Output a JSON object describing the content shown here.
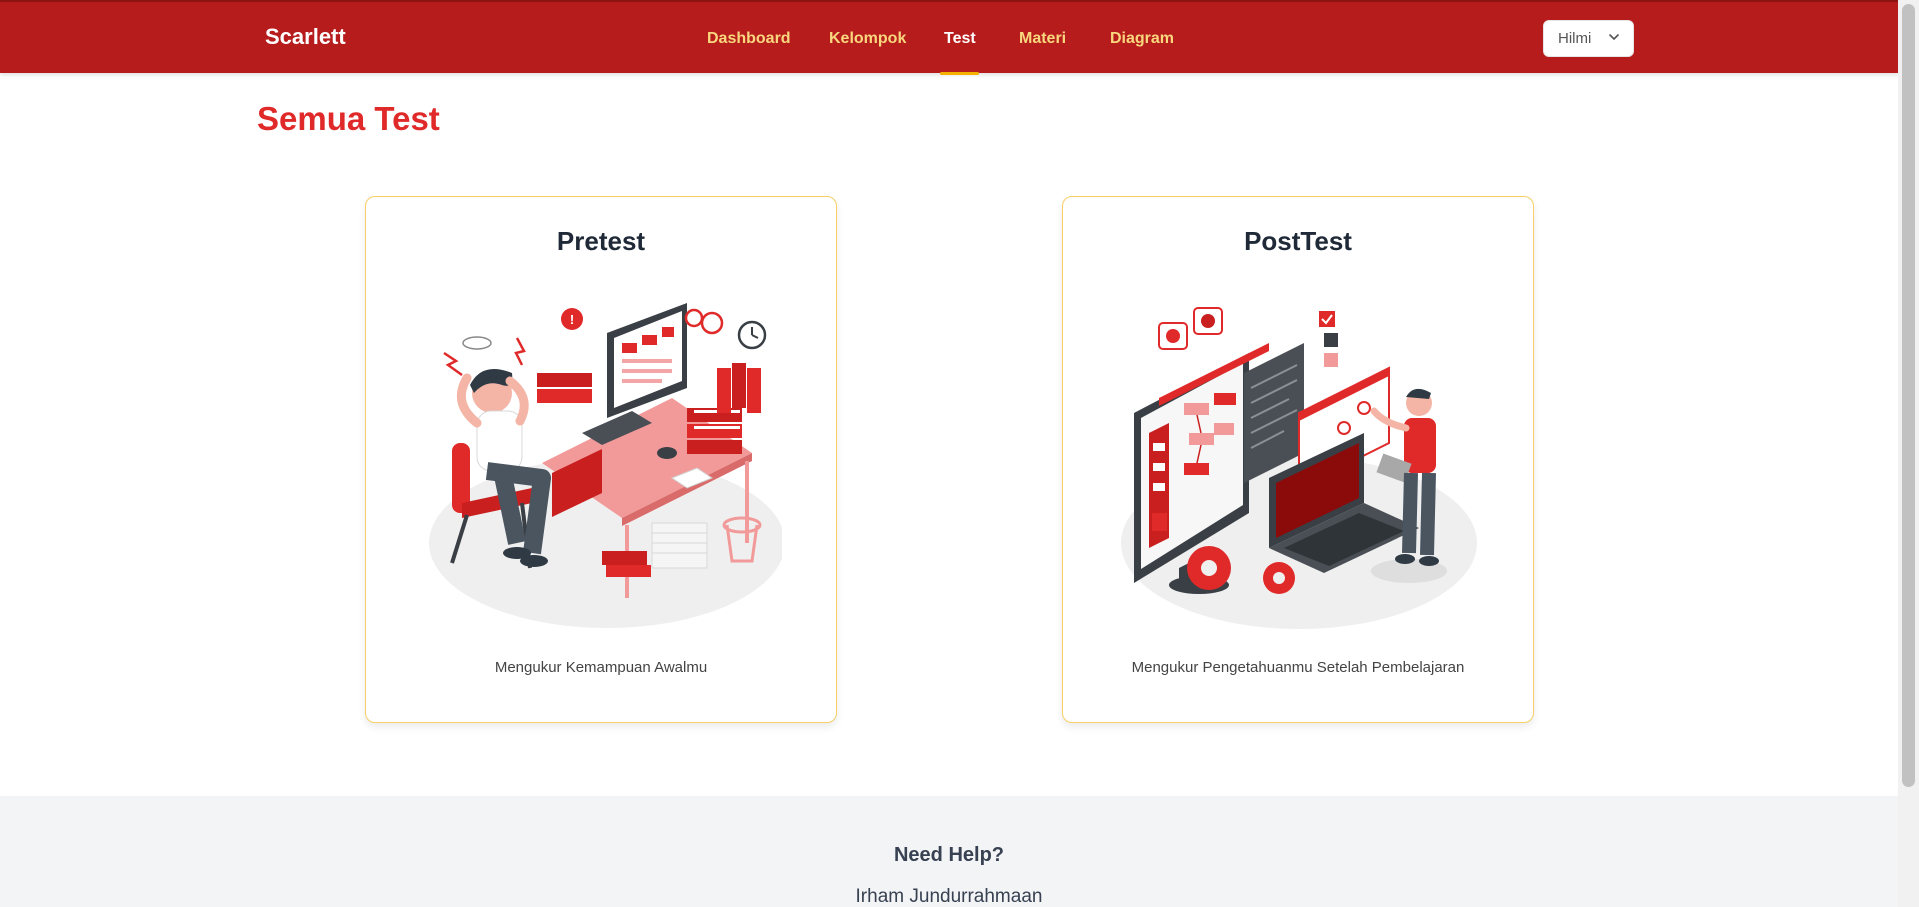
{
  "brand": "Scarlett",
  "nav": {
    "items": [
      {
        "label": "Dashboard"
      },
      {
        "label": "Kelompok"
      },
      {
        "label": "Test"
      },
      {
        "label": "Materi"
      },
      {
        "label": "Diagram"
      }
    ],
    "active": "Test",
    "user_label": "Hilmi"
  },
  "main": {
    "title": "Semua Test",
    "cards": [
      {
        "title": "Pretest",
        "description": "Mengukur Kemampuan Awalmu"
      },
      {
        "title": "PostTest",
        "description": "Mengukur Pengetahuanmu Setelah Pembelajaran"
      }
    ]
  },
  "footer": {
    "help_title": "Need Help?",
    "contact_name": "Irham Jundurrahmaan"
  },
  "colors": {
    "navbar": "#b71c1c",
    "nav_link": "#f8d77e",
    "active_underline": "#f5b100",
    "title": "#e02a2a",
    "card_border": "#f7cf66"
  }
}
